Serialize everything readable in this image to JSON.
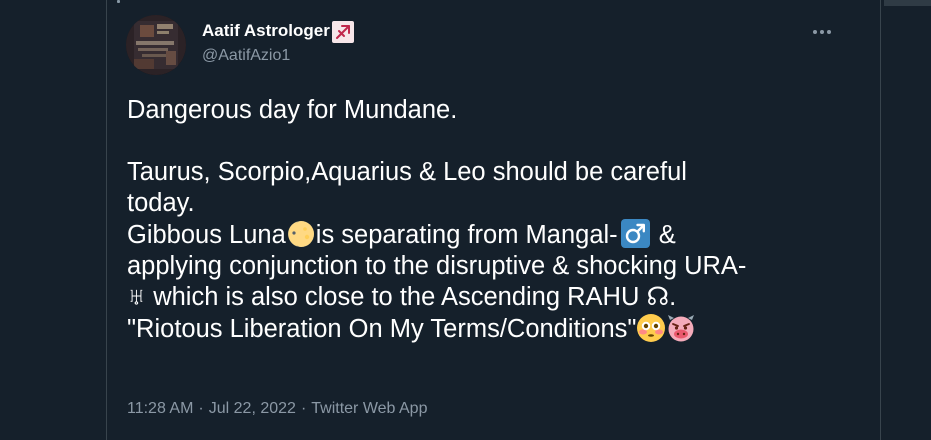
{
  "colors": {
    "background": "#15202b",
    "border": "#38444d",
    "text_primary": "#ffffff",
    "text_secondary": "#8b98a5"
  },
  "tweet": {
    "author": {
      "display_name": "Aatif Astrologer",
      "name_emoji": "sagittarius-sign-icon",
      "handle": "@AatifAzio1",
      "avatar": "profile-avatar"
    },
    "more_icon": "more-options-icon",
    "text": {
      "line1": "Dangerous day for Mundane.",
      "line2": "Taurus, Scorpio,Aquarius & Leo should be careful\ntoday.",
      "line3_pre": "Gibbous Luna",
      "line3_moon_emoji": "waxing-gibbous-moon-icon",
      "line3_mid": "is separating from Mangal-",
      "line3_mars_emoji": "mars-symbol-icon",
      "line3_post": " &",
      "line4": "applying conjunction to the disruptive & shocking URA-\n♅ which is also close to the Ascending RAHU ☊.",
      "line5": "\"Riotous Liberation On My Terms/Conditions\"",
      "line5_emoji_1": "flushed-face-icon",
      "line5_emoji_2": "cow-devil-face-icon"
    },
    "meta": {
      "time": "11:28 AM",
      "date": "Jul 22, 2022",
      "source": "Twitter Web App",
      "separator": "·"
    }
  }
}
